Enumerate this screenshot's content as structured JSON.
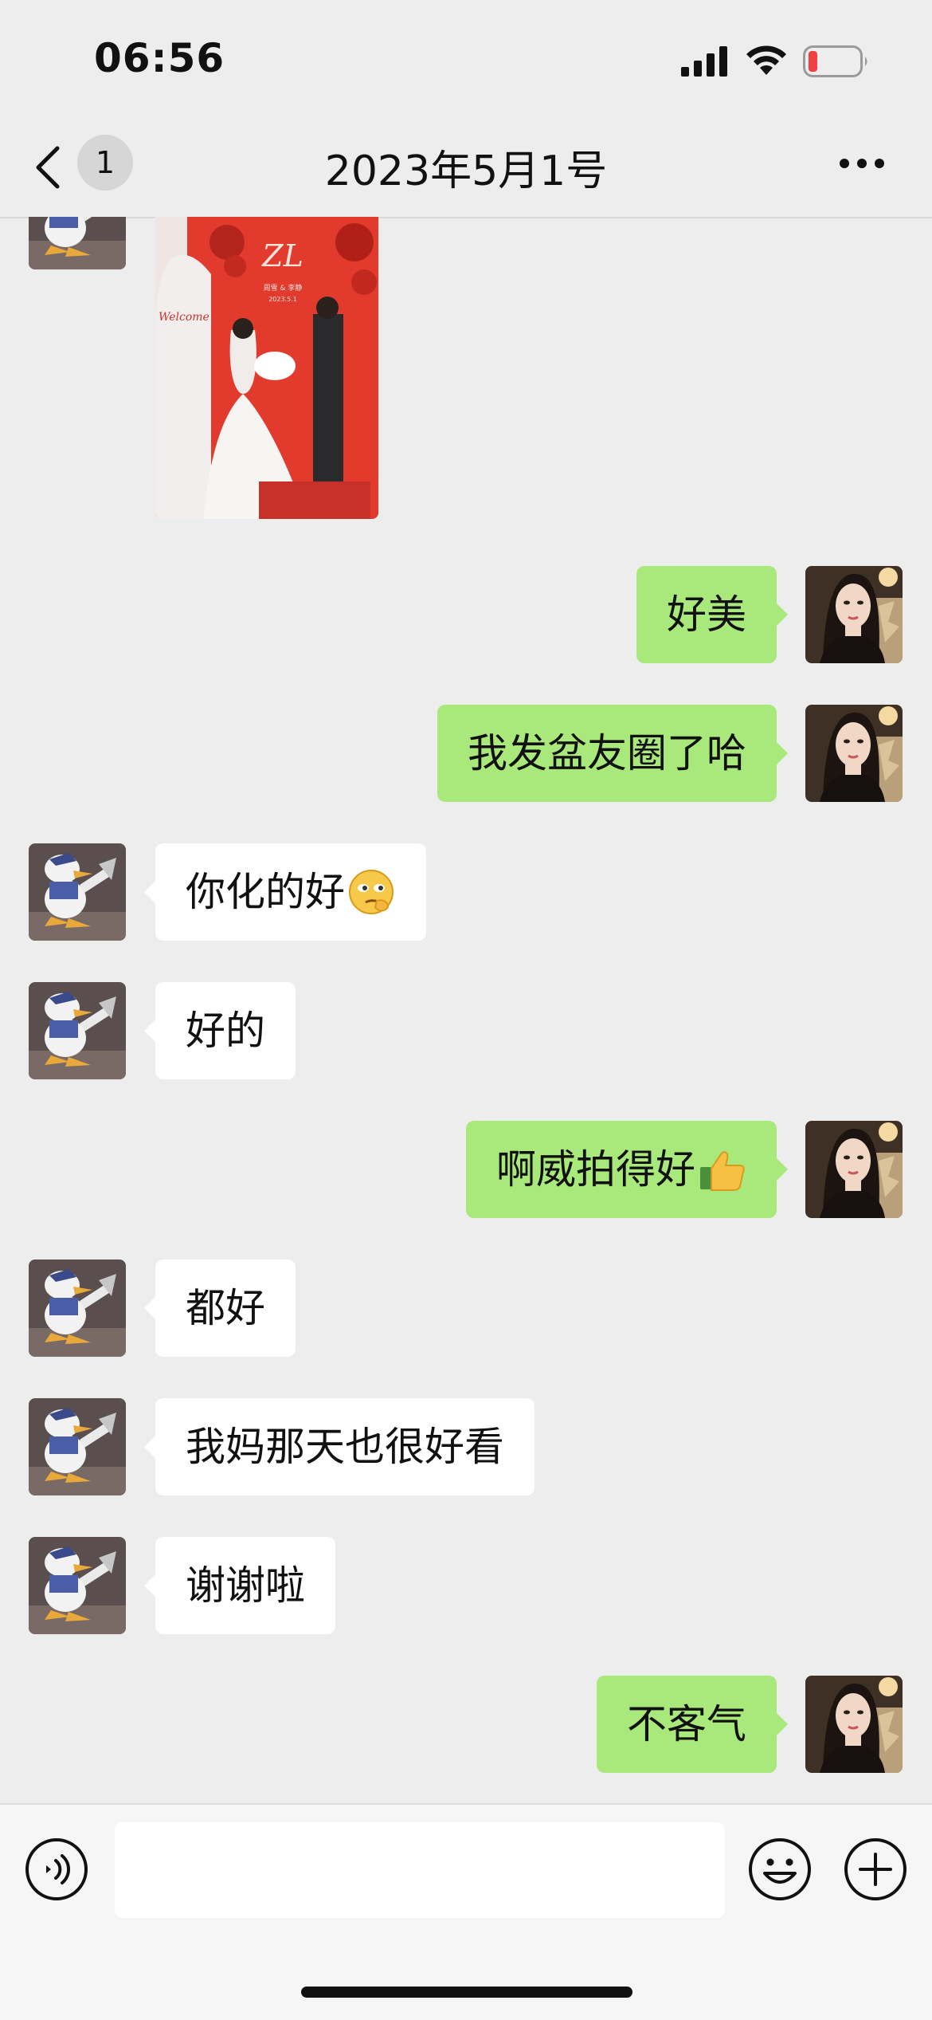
{
  "status_bar": {
    "time": "06:56"
  },
  "nav": {
    "title": "2023年5月1号",
    "unread_count": "1"
  },
  "photo": {
    "monogram": "ZL",
    "caption": "周雪 & 李静",
    "date": "2023.5.1",
    "welcome": "Welcome"
  },
  "messages": [
    {
      "side": "right",
      "text": "好美"
    },
    {
      "side": "right",
      "text": "我发盆友圈了哈"
    },
    {
      "side": "left",
      "text": "你化的好",
      "emoji": "smirk-emoji"
    },
    {
      "side": "left",
      "text": "好的"
    },
    {
      "side": "right",
      "text": "啊威拍得好",
      "emoji": "thumbs-up-emoji"
    },
    {
      "side": "left",
      "text": "都好"
    },
    {
      "side": "left",
      "text": "我妈那天也很好看"
    },
    {
      "side": "left",
      "text": "谢谢啦"
    },
    {
      "side": "right",
      "text": "不客气"
    }
  ],
  "input": {
    "placeholder": ""
  },
  "colors": {
    "sent_bubble": "#a9e97b",
    "received_bubble": "#ffffff",
    "background": "#ededed",
    "battery_low": "#f04040"
  }
}
